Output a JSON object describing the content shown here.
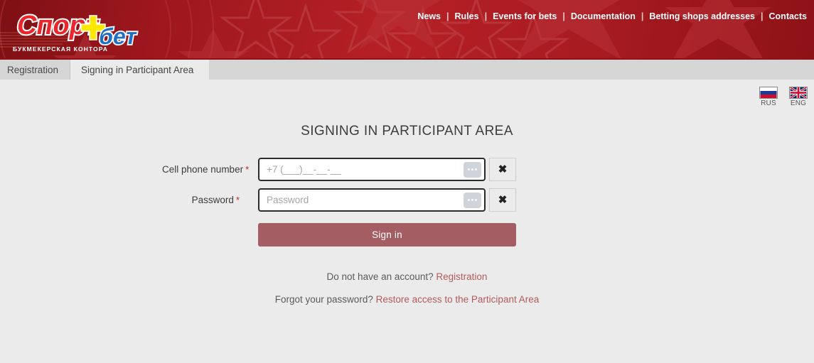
{
  "header": {
    "logo": {
      "main_text_1": "Спорт",
      "main_text_2": "бет",
      "tagline": "БУКМЕКЕРСКАЯ КОНТОРА"
    },
    "nav": [
      {
        "label": "News"
      },
      {
        "label": "Rules"
      },
      {
        "label": "Events for bets"
      },
      {
        "label": "Documentation"
      },
      {
        "label": "Betting shops addresses"
      },
      {
        "label": "Contacts"
      }
    ],
    "nav_separator": "|",
    "background_color": "#a81b22"
  },
  "tabs": [
    {
      "label": "Registration",
      "active": false
    },
    {
      "label": "Signing in Participant Area",
      "active": true
    }
  ],
  "languages": [
    {
      "code": "RUS",
      "icon": "flag-russia-icon"
    },
    {
      "code": "ENG",
      "icon": "flag-uk-icon"
    }
  ],
  "main": {
    "title": "SIGNING IN PARTICIPANT AREA",
    "fields": [
      {
        "label": "Cell phone number",
        "required_marker": "*",
        "placeholder": "+7 (___)__-__-__",
        "value": "",
        "dots_icon": "ellipsis-icon",
        "clear_icon": "✖"
      },
      {
        "label": "Password",
        "required_marker": "*",
        "placeholder": "Password",
        "value": "",
        "dots_icon": "ellipsis-icon",
        "clear_icon": "✖"
      }
    ],
    "submit_label": "Sign in",
    "submit_color": "#a35d63",
    "footer": {
      "no_account_text": "Do not have an account?",
      "registration_link": "Registration",
      "forgot_text": "Forgot your password?",
      "restore_link": "Restore access to the Participant Area",
      "link_color": "#b35a5a"
    }
  }
}
